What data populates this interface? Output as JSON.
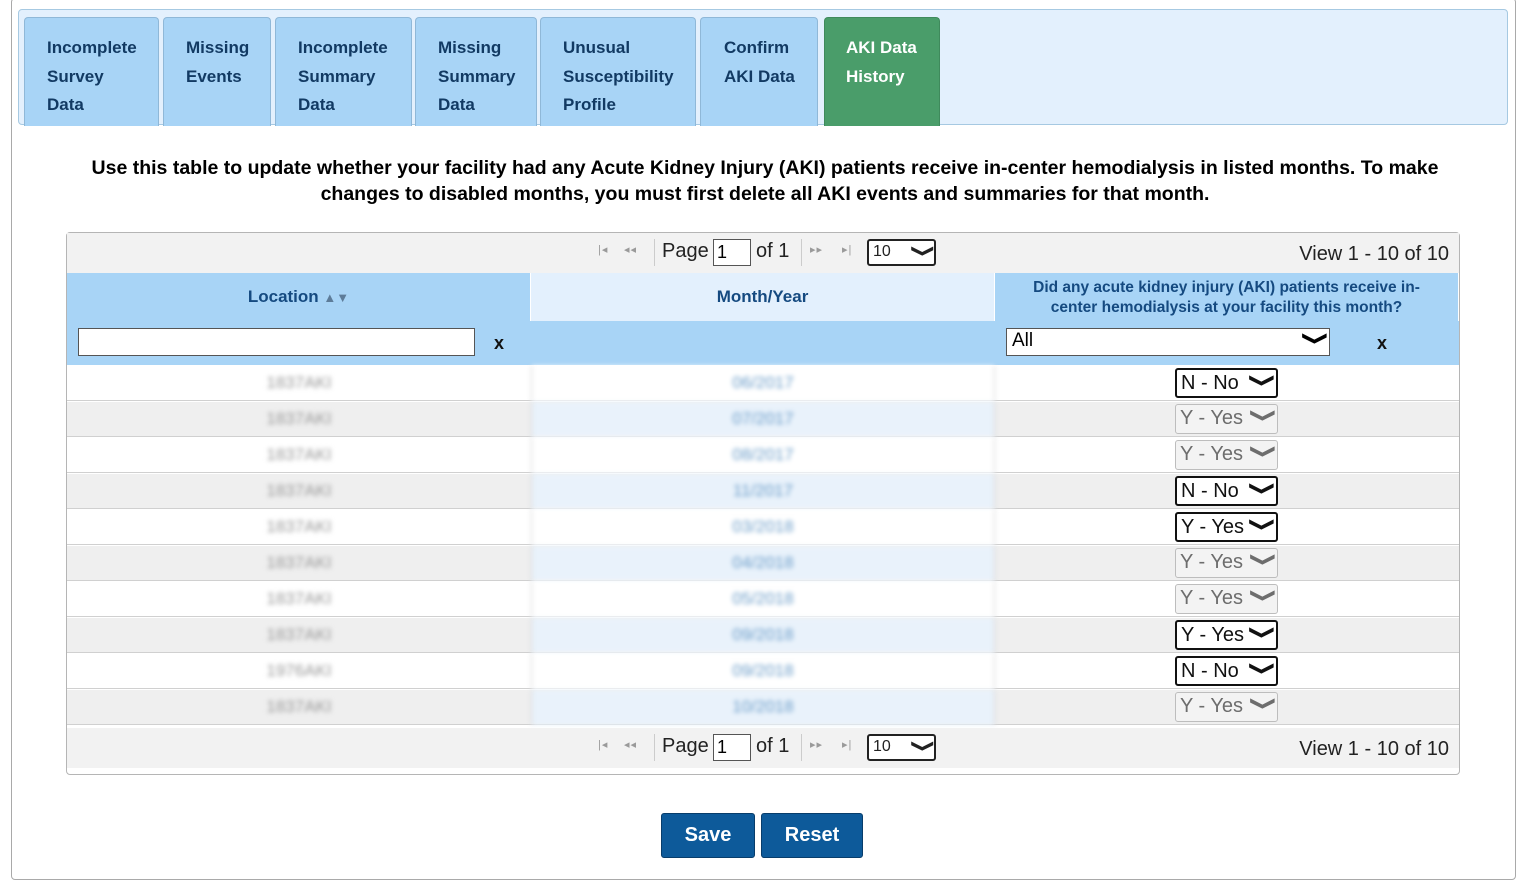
{
  "tabs": [
    {
      "label": "Incomplete\nSurvey\nData"
    },
    {
      "label": "Missing\nEvents"
    },
    {
      "label": "Incomplete\nSummary\nData"
    },
    {
      "label": "Missing\nSummary\nData"
    },
    {
      "label": "Unusual\nSusceptibility\nProfile"
    },
    {
      "label": "Confirm\nAKI Data"
    },
    {
      "label": "AKI Data\nHistory",
      "active": true
    }
  ],
  "instructions": "Use this table to update whether your facility had any Acute Kidney Injury (AKI) patients receive in-center hemodialysis in listed months. To make changes to disabled months, you must first delete all AKI events and summaries for that month.",
  "pager": {
    "page_label": "Page",
    "page_value": "1",
    "of_label": "of 1",
    "rows_per_page": "10",
    "view_info": "View 1 - 10 of 10"
  },
  "columns": {
    "location": "Location",
    "month_year": "Month/Year",
    "aki": "Did any acute kidney injury (AKI) patients receive in-center hemodialysis at your facility this month?"
  },
  "filters": {
    "location_value": "",
    "aki_filter": "All",
    "clear_label": "x"
  },
  "rows": [
    {
      "location": "1837AKI",
      "month": "06/2017",
      "value": "N - No",
      "disabled": false
    },
    {
      "location": "1837AKI",
      "month": "07/2017",
      "value": "Y - Yes",
      "disabled": true
    },
    {
      "location": "1837AKI",
      "month": "08/2017",
      "value": "Y - Yes",
      "disabled": true
    },
    {
      "location": "1837AKI",
      "month": "11/2017",
      "value": "N - No",
      "disabled": false
    },
    {
      "location": "1837AKI",
      "month": "03/2018",
      "value": "Y - Yes",
      "disabled": false
    },
    {
      "location": "1837AKI",
      "month": "04/2018",
      "value": "Y - Yes",
      "disabled": true
    },
    {
      "location": "1837AKI",
      "month": "05/2018",
      "value": "Y - Yes",
      "disabled": true
    },
    {
      "location": "1837AKI",
      "month": "09/2018",
      "value": "Y - Yes",
      "disabled": false
    },
    {
      "location": "1976AKI",
      "month": "09/2018",
      "value": "N - No",
      "disabled": false
    },
    {
      "location": "1837AKI",
      "month": "10/2018",
      "value": "Y - Yes",
      "disabled": true
    }
  ],
  "buttons": {
    "save": "Save",
    "reset": "Reset"
  },
  "icons": {
    "sort": "sort-icon",
    "chevron": "chevron-down-icon",
    "first": "first-page-icon",
    "prev": "prev-page-icon",
    "next": "next-page-icon",
    "last": "last-page-icon"
  },
  "colors": {
    "tab": "#a8d4f6",
    "active_tab": "#4a9d6a",
    "button": "#0d5a9a",
    "header_text": "#154a80"
  }
}
